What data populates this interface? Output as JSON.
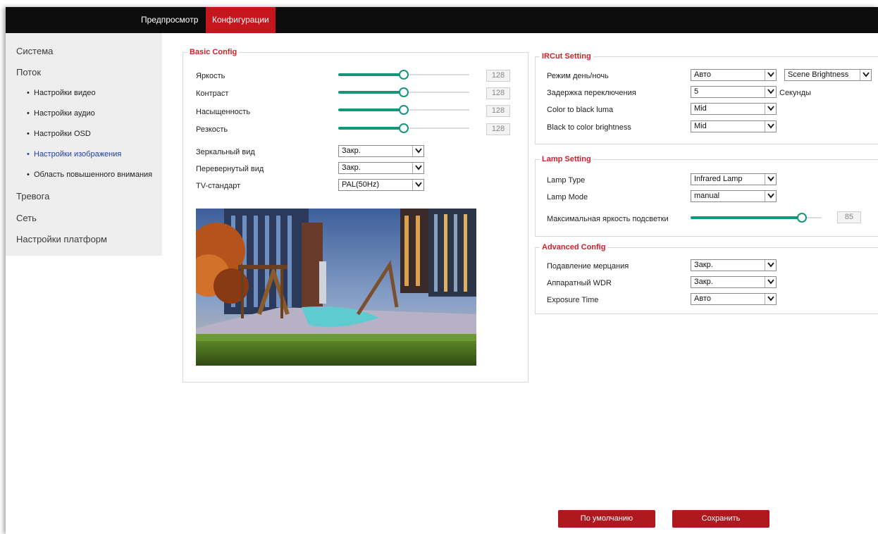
{
  "nav": {
    "tabs": [
      "Предпросмотр",
      "Конфигурации"
    ]
  },
  "sidebar": {
    "items": [
      "Система",
      "Поток",
      "Тревога",
      "Сеть",
      "Настройки платформ"
    ],
    "sub_items": [
      "Настройки видео",
      "Настройки аудио",
      "Настройки OSD",
      "Настройки изображения",
      "Область повышенного внимания"
    ],
    "active_sub": "Настройки изображения"
  },
  "basic": {
    "legend": "Basic Config",
    "sliders": [
      {
        "label": "Яркость",
        "value": "128"
      },
      {
        "label": "Контраст",
        "value": "128"
      },
      {
        "label": "Насыщенность",
        "value": "128"
      },
      {
        "label": "Резкость",
        "value": "128"
      }
    ],
    "slider_fraction": 0.5,
    "selects": [
      {
        "label": "Зеркальный вид",
        "value": "Закр."
      },
      {
        "label": "Перевернутый вид",
        "value": "Закр."
      },
      {
        "label": "TV-стандарт",
        "value": "PAL(50Hz)"
      }
    ]
  },
  "ircut": {
    "legend": "IRCut Setting",
    "rows": [
      {
        "label": "Режим день/ночь",
        "value": "Авто",
        "extra": "Scene Brightness"
      },
      {
        "label": "Задержка переключения",
        "value": "5",
        "suffix": "Секунды"
      },
      {
        "label": "Color to black luma",
        "value": "Mid"
      },
      {
        "label": "Black to color brightness",
        "value": "Mid"
      }
    ]
  },
  "lamp": {
    "legend": "Lamp Setting",
    "rows": [
      {
        "label": "Lamp Type",
        "value": "Infrared Lamp"
      },
      {
        "label": "Lamp Mode",
        "value": "manual"
      }
    ],
    "brightness_label": "Максимальная яркость подсветки",
    "brightness_value": "85",
    "brightness_fraction": 0.85
  },
  "advanced": {
    "legend": "Advanced Config",
    "rows": [
      {
        "label": "Подавление мерцания",
        "value": "Закр."
      },
      {
        "label": "Аппаратный WDR",
        "value": "Закр."
      },
      {
        "label": "Exposure Time",
        "value": "Авто"
      }
    ]
  },
  "buttons": {
    "default": "По умолчанию",
    "save": "Сохранить"
  },
  "colors": {
    "accent": "#c4161c",
    "slider": "#15967a",
    "topbar": "#0c0c0c"
  }
}
